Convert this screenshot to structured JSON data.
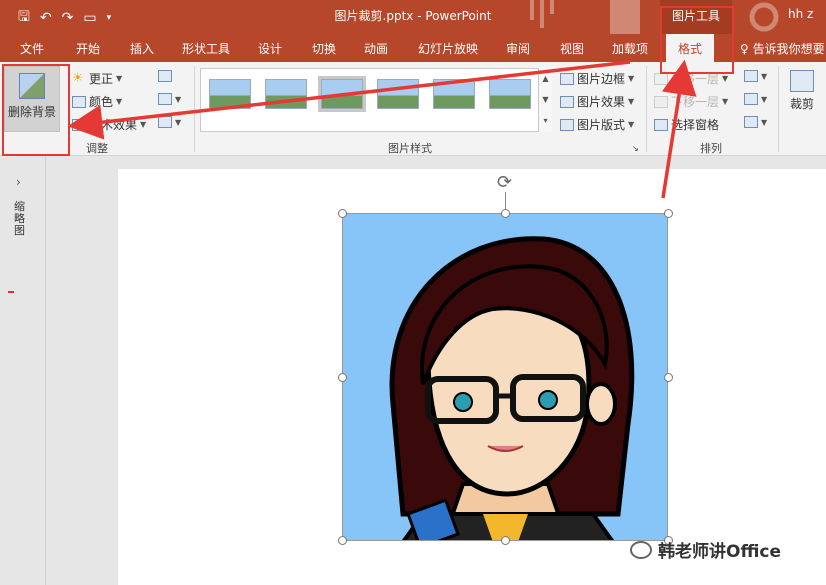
{
  "title_bar": {
    "document_title": "图片裁剪.pptx  -  PowerPoint",
    "context_group": "图片工具",
    "user": "hh z"
  },
  "tabs": [
    "文件",
    "开始",
    "插入",
    "形状工具",
    "设计",
    "切换",
    "动画",
    "幻灯片放映",
    "审阅",
    "视图",
    "加载项",
    "格式"
  ],
  "active_tab": "格式",
  "tell_me": "告诉我你想要",
  "ribbon": {
    "adjust": {
      "remove_background": "删除背景",
      "corrections": "更正",
      "color": "颜色",
      "artistic_effects": "艺术效果",
      "group_label": "调整"
    },
    "picture_styles": {
      "border": "图片边框",
      "effects": "图片效果",
      "layout": "图片版式",
      "group_label": "图片样式"
    },
    "arrange": {
      "bring_forward": "上移一层",
      "send_backward": "下移一层",
      "selection_pane": "选择窗格",
      "group_label": "排列"
    },
    "size": {
      "crop": "裁剪"
    }
  },
  "left_panel": {
    "label": "缩略图"
  },
  "watermark": "韩老师讲Office",
  "colors": {
    "accent": "#b7472a",
    "highlight": "#e53935",
    "picture_bg": "#87c4f7"
  }
}
